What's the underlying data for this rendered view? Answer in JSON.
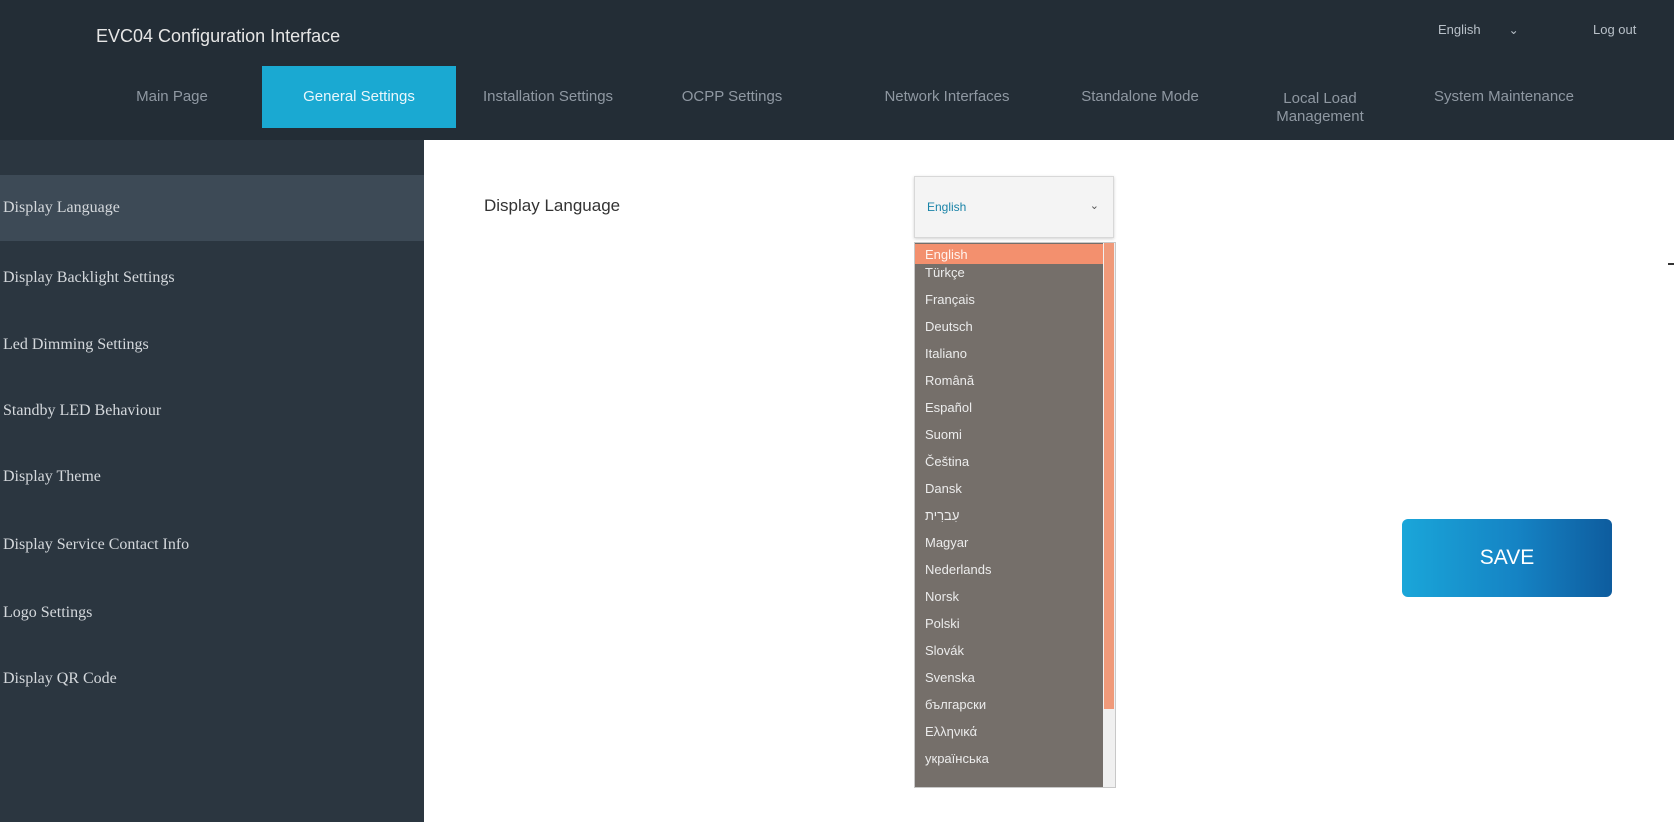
{
  "header": {
    "title": "EVC04 Configuration Interface",
    "language": "English",
    "logout": "Log out"
  },
  "nav": {
    "tabs": [
      {
        "label": "Main Page",
        "active": false
      },
      {
        "label": "General Settings",
        "active": true
      },
      {
        "label": "Installation Settings",
        "active": false
      },
      {
        "label": "OCPP Settings",
        "active": false
      },
      {
        "label": "Network Interfaces",
        "active": false
      },
      {
        "label": "Standalone Mode",
        "active": false
      },
      {
        "label": "Local Load Management",
        "active": false
      },
      {
        "label": "System Maintenance",
        "active": false
      }
    ]
  },
  "sidebar": {
    "items": [
      {
        "label": "Display Language",
        "active": true
      },
      {
        "label": "Display Backlight Settings",
        "active": false
      },
      {
        "label": "Led Dimming Settings",
        "active": false
      },
      {
        "label": "Standby LED Behaviour",
        "active": false
      },
      {
        "label": "Display Theme",
        "active": false
      },
      {
        "label": "Display Service Contact Info",
        "active": false
      },
      {
        "label": "Logo Settings",
        "active": false
      },
      {
        "label": "Display QR Code",
        "active": false
      }
    ]
  },
  "main": {
    "field_label": "Display Language",
    "selected_language": "English",
    "options": [
      "English",
      "Türkçe",
      "Français",
      "Deutsch",
      "Italiano",
      "Română",
      "Español",
      "Suomi",
      "Čeština",
      "Dansk",
      "עִברִית",
      "Magyar",
      "Nederlands",
      "Norsk",
      "Polski",
      "Slovák",
      "Svenska",
      "български",
      "Ελληνικά",
      "українська"
    ],
    "save_label": "SAVE"
  },
  "colors": {
    "header_bg": "#232d36",
    "active_tab": "#1aa9d2",
    "sidebar_bg": "#2b3640",
    "option_selected": "#f3906e",
    "save_gradient_start": "#1aa6d9",
    "save_gradient_end": "#0e5c9e"
  },
  "icons": {
    "language_chevron": "chevron-down-icon",
    "select_chevron": "chevron-down-icon"
  }
}
